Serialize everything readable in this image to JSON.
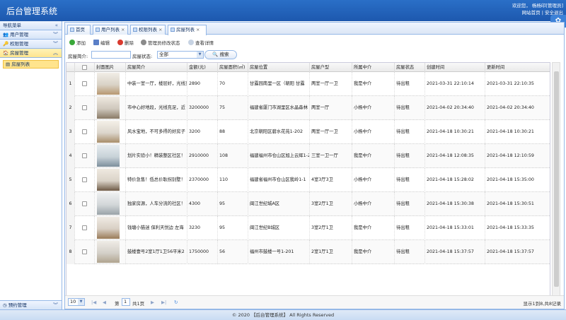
{
  "header": {
    "title": "后台管理系统",
    "welcome": "欢迎您，  杨杨印[管理员]",
    "links": "网站首页 | 安全退出"
  },
  "sidebar": {
    "head": "导航菜单",
    "menus": [
      {
        "label": "用户管理"
      },
      {
        "label": "权限管理"
      },
      {
        "label": "房屋管理"
      }
    ],
    "sub_item": "房屋列表",
    "bottom": "预约管理"
  },
  "tabs": [
    {
      "label": "首页"
    },
    {
      "label": "用户列表"
    },
    {
      "label": "权限列表"
    },
    {
      "label": "房屋列表"
    }
  ],
  "toolbar": {
    "add": "添加",
    "edit": "编辑",
    "delete": "删除",
    "change_status": "管理员修改状态",
    "view": "查看详情"
  },
  "search": {
    "intro_label": "房屋简介:",
    "status_label": "房屋状态:",
    "status_value": "全部",
    "button": "搜索"
  },
  "columns": [
    "封面图片",
    "房屋简介",
    "金额(元)",
    "房屋面积(㎡)",
    "房屋位置",
    "房屋户型",
    "所属中介",
    "房屋状态",
    "创建时间",
    "更新时间"
  ],
  "rows": [
    {
      "n": "1",
      "intro": "中装一室一厅，楼层好，光线充",
      "price": "2890",
      "area": "70",
      "loc": "甘露园南里一区（朝阳 甘露",
      "type": "两室一厅一卫",
      "agent": "我是中介",
      "status": "待出租",
      "created": "2021-03-31 22:10:14",
      "updated": "2021-03-31 22:10:35"
    },
    {
      "n": "2",
      "intro": "市中心好地段，光线充足，近",
      "price": "3200000",
      "area": "75",
      "loc": "福建省厦门市湖里区水晶森林",
      "type": "两室一厅",
      "agent": "小杨中介",
      "status": "待出租",
      "created": "2021-04-02 20:34:40",
      "updated": "2021-04-02 20:34:40"
    },
    {
      "n": "3",
      "intro": "风水宝地，不可多得的好房子",
      "price": "3200",
      "area": "88",
      "loc": "北京朝阳区碧水花苑1-202",
      "type": "两室一厅一卫",
      "agent": "小杨中介",
      "status": "待出租",
      "created": "2021-04-18 10:30:21",
      "updated": "2021-04-18 10:30:21"
    },
    {
      "n": "4",
      "intro": "划片实验小！精装整区社区！",
      "price": "2910000",
      "area": "108",
      "loc": "福建福州市仓山区旭上云辉1-2",
      "type": "三室一卫一厅",
      "agent": "我是中介",
      "status": "待出租",
      "created": "2021-04-18 12:08:35",
      "updated": "2021-04-18 12:10:59"
    },
    {
      "n": "5",
      "intro": "特价急售！低总价耿拐别墅！",
      "price": "2370000",
      "area": "110",
      "loc": "福建省福州市仓山区我岭1-1",
      "type": "4室3厅3卫",
      "agent": "小杨中介",
      "status": "待出租",
      "created": "2021-04-18 15:28:02",
      "updated": "2021-04-18 15:35:00"
    },
    {
      "n": "6",
      "intro": "独家房源，人车分流的社区！",
      "price": "4300",
      "area": "95",
      "loc": "闽江世纪城A区",
      "type": "3室2厅1卫",
      "agent": "小杨中介",
      "status": "待出租",
      "created": "2021-04-18 15:30:38",
      "updated": "2021-04-18 15:30:51"
    },
    {
      "n": "7",
      "intro": "钱塘小猫迷 保利天悦边 左海",
      "price": "3230",
      "area": "95",
      "loc": "闽江世纪B城区",
      "type": "3室2厅1卫",
      "agent": "我是中介",
      "status": "待出租",
      "created": "2021-04-18 15:33:01",
      "updated": "2021-04-18 15:33:35"
    },
    {
      "n": "8",
      "intro": "鼓楼壹号2室1厅1卫56平米2",
      "price": "1750000",
      "area": "56",
      "loc": "福州市鼓楼一号1-201",
      "type": "2室1厅1卫",
      "agent": "我是中介",
      "status": "待出租",
      "created": "2021-04-18 15:37:57",
      "updated": "2021-04-18 15:37:57"
    }
  ],
  "pager": {
    "size": "10",
    "page": "1",
    "page_prefix": "第",
    "total_pages": "共1页",
    "summary": "显示1到8,共8记录"
  },
  "footer": "© 2020 【后台管理系统】 All Rights Reserved"
}
